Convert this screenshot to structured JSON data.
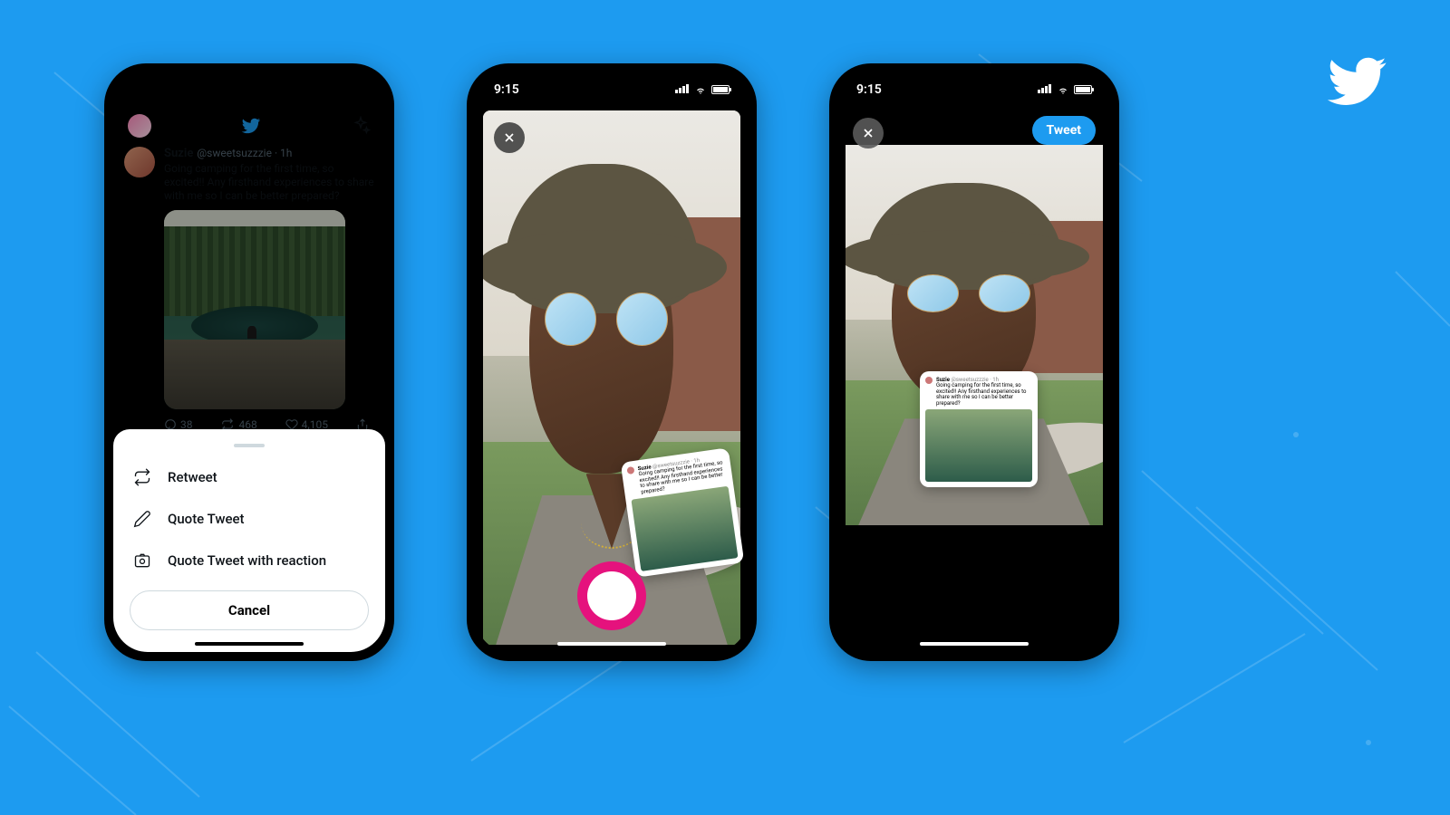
{
  "status_time": "9:15",
  "phone1": {
    "tweet": {
      "name": "Suzie",
      "handle": "@sweetsuzzzie · 1h",
      "text": "Going camping for the first time, so excited!! Any firsthand experiences to share with me so I can be better prepared?",
      "replies": "38",
      "retweets": "468",
      "likes": "4,105"
    },
    "sheet": {
      "retweet": "Retweet",
      "quote": "Quote Tweet",
      "reaction": "Quote Tweet with reaction",
      "cancel": "Cancel"
    }
  },
  "phone3": {
    "tweet_button": "Tweet"
  },
  "mini_tweet": {
    "name": "Suzie",
    "handle": "@sweetsuzzzie · 1h",
    "text": "Going camping for the first time, so excited!! Any firsthand experiences to share with me so I can be better prepared?"
  },
  "colors": {
    "brand": "#1d9bf0",
    "record": "#e5127d"
  }
}
